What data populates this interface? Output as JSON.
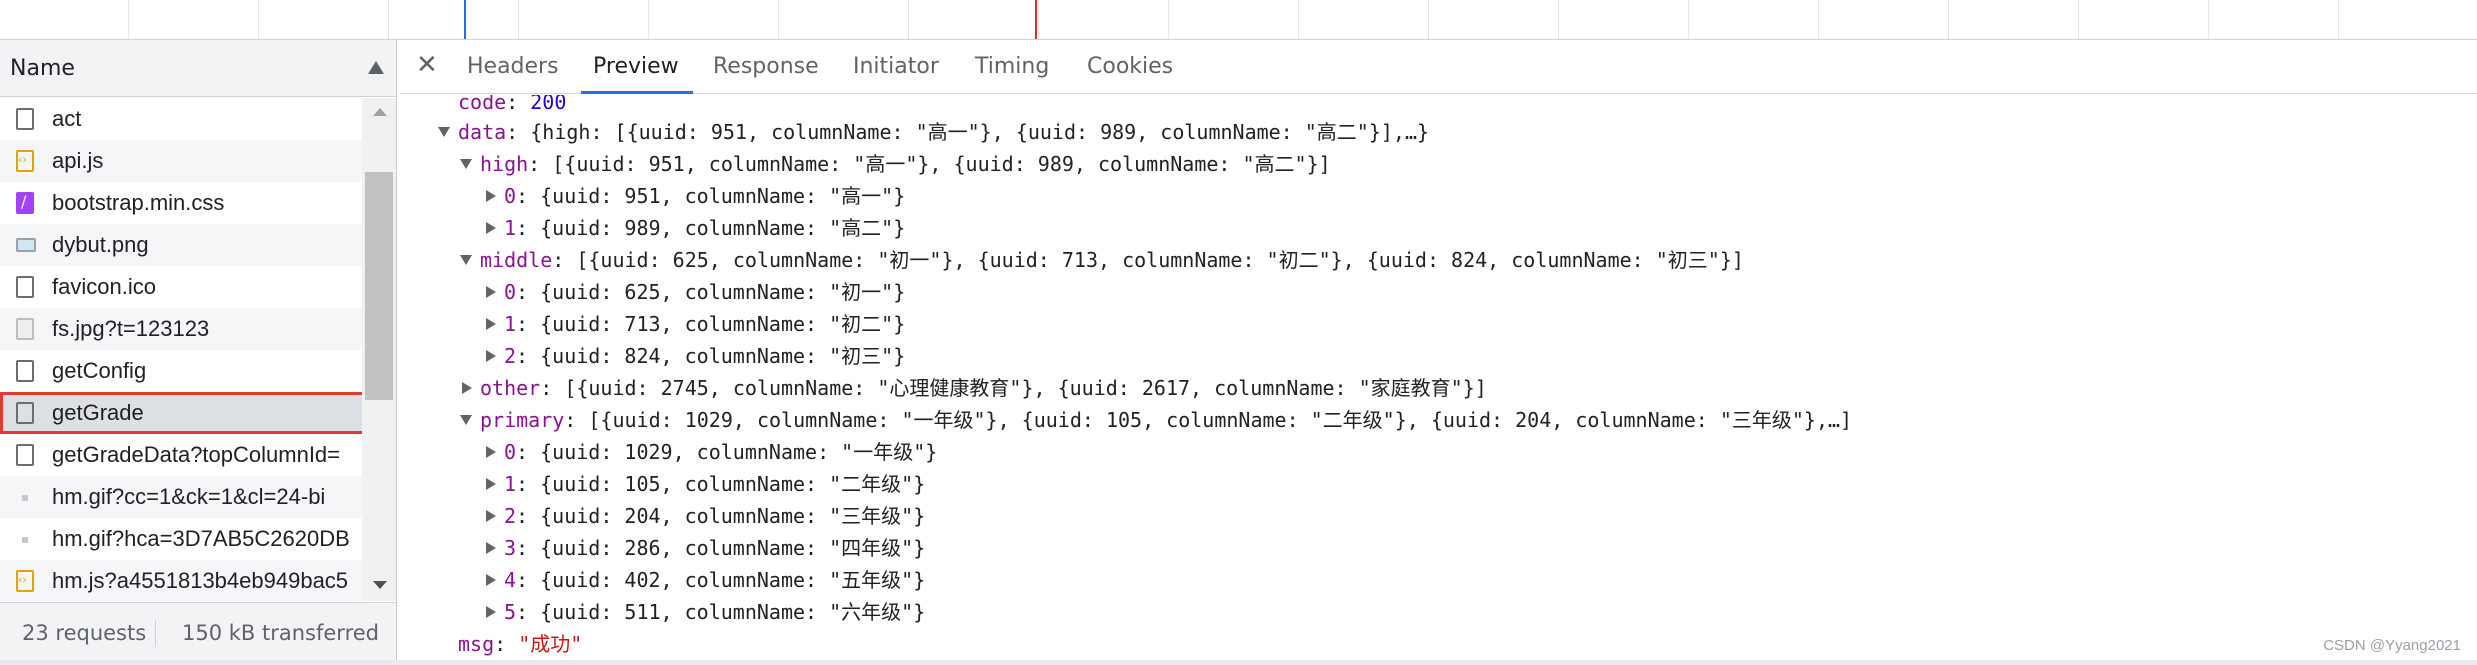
{
  "colors": {
    "accent": "#1a73e8",
    "selection_outline": "#e53935",
    "key": "#881391",
    "number": "#1c00cf",
    "string": "#c41a16"
  },
  "name_panel": {
    "header": "Name",
    "requests": [
      {
        "label": "act",
        "icon": "document-icon"
      },
      {
        "label": "api.js",
        "icon": "script-icon"
      },
      {
        "label": "bootstrap.min.css",
        "icon": "stylesheet-icon"
      },
      {
        "label": "dybut.png",
        "icon": "image-icon"
      },
      {
        "label": "favicon.ico",
        "icon": "document-icon"
      },
      {
        "label": "fs.jpg?t=123123",
        "icon": "image-file-icon"
      },
      {
        "label": "getConfig",
        "icon": "document-icon"
      },
      {
        "label": "getGrade",
        "icon": "document-icon"
      },
      {
        "label": "getGradeData?topColumnId=",
        "icon": "document-icon"
      },
      {
        "label": "hm.gif?cc=1&ck=1&cl=24-bi",
        "icon": "pixel-icon"
      },
      {
        "label": "hm.gif?hca=3D7AB5C2620DB",
        "icon": "pixel-icon"
      },
      {
        "label": "hm.js?a4551813b4eb949bac5",
        "icon": "script-icon"
      }
    ],
    "selected": "getGrade",
    "status": {
      "requests": "23 requests",
      "transferred": "150 kB transferred"
    }
  },
  "tabs": [
    "Headers",
    "Preview",
    "Response",
    "Initiator",
    "Timing",
    "Cookies"
  ],
  "active_tab": "Preview",
  "preview": {
    "code_key": "code",
    "code_value": "200",
    "data_key": "data",
    "data_summary": "{high: [{uuid: 951, columnName: \"高一\"}, {uuid: 989, columnName: \"高二\"}],…}",
    "high_key": "high",
    "high_summary": "[{uuid: 951, columnName: \"高一\"}, {uuid: 989, columnName: \"高二\"}]",
    "high_items": [
      {
        "idx": "0",
        "uuid": "951",
        "name": "\"高一\""
      },
      {
        "idx": "1",
        "uuid": "989",
        "name": "\"高二\""
      }
    ],
    "middle_key": "middle",
    "middle_summary": "[{uuid: 625, columnName: \"初一\"}, {uuid: 713, columnName: \"初二\"}, {uuid: 824, columnName: \"初三\"}]",
    "middle_items": [
      {
        "idx": "0",
        "uuid": "625",
        "name": "\"初一\""
      },
      {
        "idx": "1",
        "uuid": "713",
        "name": "\"初二\""
      },
      {
        "idx": "2",
        "uuid": "824",
        "name": "\"初三\""
      }
    ],
    "other_key": "other",
    "other_summary": "[{uuid: 2745, columnName: \"心理健康教育\"}, {uuid: 2617, columnName: \"家庭教育\"}]",
    "primary_key": "primary",
    "primary_summary": "[{uuid: 1029, columnName: \"一年级\"}, {uuid: 105, columnName: \"二年级\"}, {uuid: 204, columnName: \"三年级\"},…]",
    "primary_items": [
      {
        "idx": "0",
        "uuid": "1029",
        "name": "\"一年级\""
      },
      {
        "idx": "1",
        "uuid": "105",
        "name": "\"二年级\""
      },
      {
        "idx": "2",
        "uuid": "204",
        "name": "\"三年级\""
      },
      {
        "idx": "3",
        "uuid": "286",
        "name": "\"四年级\""
      },
      {
        "idx": "4",
        "uuid": "402",
        "name": "\"五年级\""
      },
      {
        "idx": "5",
        "uuid": "511",
        "name": "\"六年级\""
      }
    ],
    "msg_key": "msg",
    "msg_value": "\"成功\""
  },
  "watermark": "CSDN @Yyang2021"
}
